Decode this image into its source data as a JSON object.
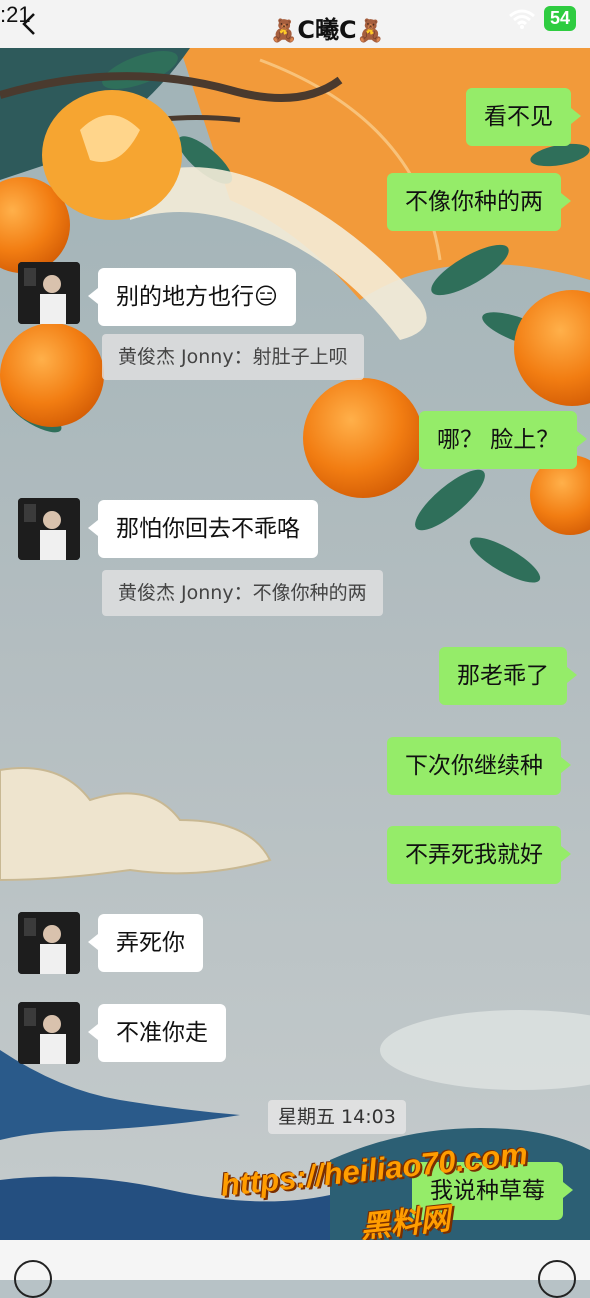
{
  "status_bar": {
    "time": ":21",
    "battery": "54"
  },
  "header": {
    "title": "C曦C"
  },
  "messages": [
    {
      "side": "right",
      "text": "看不见"
    },
    {
      "side": "right",
      "text": "不像你种的两"
    },
    {
      "side": "left",
      "text": "别的地方也行😑"
    },
    {
      "side": "quote",
      "text": "黄俊杰 Jonny：射肚子上呗"
    },
    {
      "side": "right",
      "text": "哪？ 脸上？"
    },
    {
      "side": "left",
      "text": "那怕你回去不乖咯"
    },
    {
      "side": "quote",
      "text": "黄俊杰 Jonny：不像你种的两"
    },
    {
      "side": "right",
      "text": "那老乖了"
    },
    {
      "side": "right",
      "text": "下次你继续种"
    },
    {
      "side": "right",
      "text": "不弄死我就好"
    },
    {
      "side": "left",
      "text": "弄死你"
    },
    {
      "side": "left",
      "text": "不准你走"
    },
    {
      "side": "right",
      "text": "我说种草莓"
    }
  ],
  "timestamp": "星期五 14:03",
  "watermark": {
    "line1": "https://heiliao70.com",
    "line2": "黑料网"
  },
  "colors": {
    "sent": "#95ec69",
    "received": "#ffffff",
    "accent": "#f28a1c"
  }
}
